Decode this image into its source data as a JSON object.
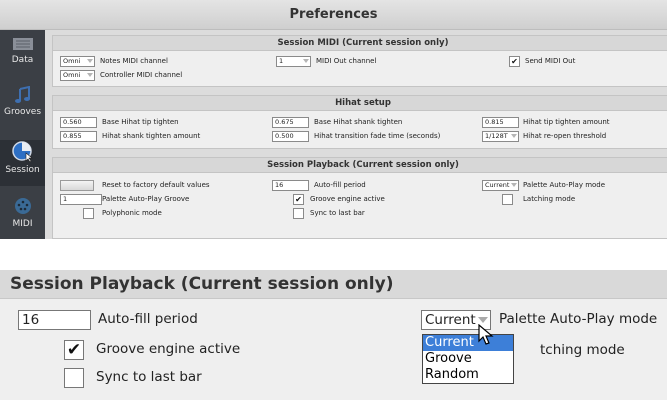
{
  "window": {
    "title": "Preferences"
  },
  "sidebar": {
    "items": [
      {
        "label": "Data",
        "icon": "data-icon"
      },
      {
        "label": "Grooves",
        "icon": "music-note-icon"
      },
      {
        "label": "Session",
        "icon": "dial-icon"
      },
      {
        "label": "MIDI",
        "icon": "midi-port-icon"
      }
    ]
  },
  "session_midi": {
    "title": "Session MIDI (Current session only)",
    "notes_channel_value": "Omni",
    "notes_channel_label": "Notes MIDI channel",
    "controller_channel_value": "Omni",
    "controller_channel_label": "Controller MIDI channel",
    "midi_out_channel_value": "1",
    "midi_out_channel_label": "MIDI Out channel",
    "send_midi_out_label": "Send MIDI Out",
    "send_midi_out_checked": true
  },
  "hihat": {
    "title": "Hihat setup",
    "base_tip_value": "0.560",
    "base_tip_label": "Base Hihat tip tighten",
    "base_shank_value": "0.675",
    "base_shank_label": "Base Hihat shank tighten",
    "tip_amount_value": "0.815",
    "tip_amount_label": "Hihat tip tighten amount",
    "shank_amount_value": "0.855",
    "shank_amount_label": "Hihat shank tighten amount",
    "fade_time_value": "0.500",
    "fade_time_label": "Hihat transition fade time (seconds)",
    "reopen_value": "1/128T",
    "reopen_label": "Hihat re-open threshold"
  },
  "playback": {
    "title": "Session Playback (Current session only)",
    "reset_label": "Reset to factory default values",
    "autofill_value": "16",
    "autofill_label": "Auto-fill period",
    "autoplay_mode_value": "Current",
    "autoplay_mode_label": "Palette Auto-Play mode",
    "palette_groove_value": "1",
    "palette_groove_label": "Palette Auto-Play Groove",
    "groove_engine_label": "Groove engine active",
    "groove_engine_checked": true,
    "latching_label": "Latching mode",
    "polyphonic_label": "Polyphonic mode",
    "sync_label": "Sync to last bar"
  },
  "zoom": {
    "title": "Session Playback (Current session only)",
    "autofill_value": "16",
    "autofill_label": "Auto-fill period",
    "groove_engine_label": "Groove engine active",
    "sync_label": "Sync to last bar",
    "mode_value": "Current",
    "mode_label": "Palette Auto-Play mode",
    "latching_label_partial": "tching mode",
    "options": [
      "Current",
      "Groove",
      "Random"
    ],
    "highlighted_option": "Current"
  }
}
